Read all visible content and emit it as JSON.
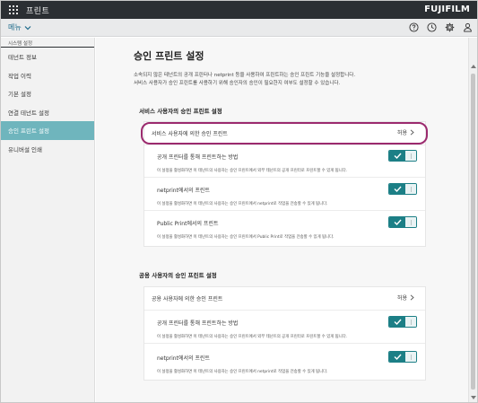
{
  "header": {
    "app_title": "프린트",
    "brand": "FUJIFILM",
    "menu_label": "메뉴",
    "icons": [
      "help-icon",
      "clock-icon",
      "gear-icon",
      "user-icon"
    ]
  },
  "sidebar": {
    "section_label": "시스템 설정",
    "items": [
      {
        "label": "테넌트 정보"
      },
      {
        "label": "작업 이력"
      },
      {
        "label": "기본 설정"
      },
      {
        "label": "연결 테넌트 설정"
      },
      {
        "label": "승인 프린트 설정"
      },
      {
        "label": "유니버설 인쇄"
      }
    ],
    "active_index": 4
  },
  "main": {
    "title": "승인 프린트 설정",
    "description_line1": "소속되지 않은 테넌트의 공개 프린터나 netprint 등을 사용하여 프린트하는 승인 프린트 기능을 설정합니다.",
    "description_line2": "서비스 사용자가 승인 프린트를 사용하기 위해 승인자의 승인이 필요한지 여부도 설정할 수 있습니다.",
    "section1": {
      "title": "서비스 사용자의 승인 프린트 설정",
      "head_title": "서비스 사용자에 의한 승인 프린트",
      "head_value": "허용",
      "items": [
        {
          "title": "공개 프린터를 통해 프린트하는 방법",
          "desc": "이 설정을 활성화하면 이 테넌트의 사용자는 승인 프린트에서 외부 테넌트의 공개 프린터로 프린트할 수 있게 됩니다.",
          "enabled": true
        },
        {
          "title": "netprint에서의 프린트",
          "desc": "이 설정을 활성화하면 이 테넌트의 사용자는 승인 프린트에서 netprint로 작업을 전송할 수 있게 됩니다.",
          "enabled": true
        },
        {
          "title": "Public Print에서의 프린트",
          "desc": "이 설정을 활성화하면 이 테넌트의 사용자는 승인 프린트에서 Public Print로 작업을 전송할 수 있게 됩니다.",
          "enabled": true
        }
      ]
    },
    "section2": {
      "title": "공용 사용자의 승인 프린트 설정",
      "head_title": "공용 사용자에 의한 승인 프린트",
      "head_value": "허용",
      "items": [
        {
          "title": "공개 프린터를 통해 프린트하는 방법",
          "desc": "이 설정을 활성화하면 이 테넌트의 사용자는 승인 프린트에서 외부 테넌트의 공개 프린터로 프린트할 수 있게 됩니다.",
          "enabled": true
        },
        {
          "title": "netprint에서의 프린트",
          "desc": "이 설정을 활성화하면 이 테넌트의 사용자는 승인 프린트에서 netprint로 작업을 전송할 수 있게 됩니다.",
          "enabled": true
        }
      ]
    }
  },
  "colors": {
    "topbar": "#2b2f33",
    "accent": "#1c7f86",
    "sidebar_active": "#6fb5bd",
    "highlight": "#9b2a6e"
  }
}
